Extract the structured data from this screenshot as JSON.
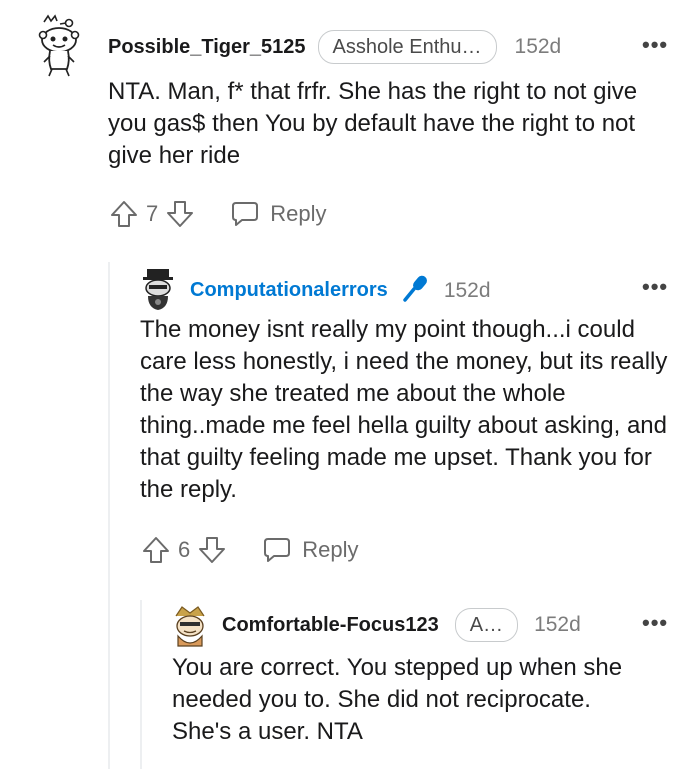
{
  "comments": [
    {
      "username": "Possible_Tiger_5125",
      "flair": "Asshole Enthu…",
      "age": "152d",
      "more": "•••",
      "body": "NTA. Man, f* that frfr. She has the right to not give you gas$ then You by default have the right to not give her ride",
      "votes": "7",
      "reply_label": "Reply"
    },
    {
      "username": "Computationalerrors",
      "age": "152d",
      "more": "•••",
      "body": "The money isnt really my point though...i could care less honestly, i need the money, but its really the way she treated me about the whole thing..made me feel hella guilty about asking, and that guilty feeling made me upset. Thank you for the reply.",
      "votes": "6",
      "reply_label": "Reply"
    },
    {
      "username": "Comfortable-Focus123",
      "flair": "A…",
      "age": "152d",
      "more": "•••",
      "body": "You are correct. You stepped up when she needed you to. She did not reciprocate. She's a user. NTA"
    }
  ],
  "colors": {
    "accent_blue": "#0079d3",
    "text": "#1a1a1b",
    "muted": "#7c7c7c"
  },
  "icons": [
    "snoo-avatar-icon",
    "upvote-icon",
    "downvote-icon",
    "reply-bubble-icon",
    "microphone-icon",
    "more-options-icon"
  ]
}
